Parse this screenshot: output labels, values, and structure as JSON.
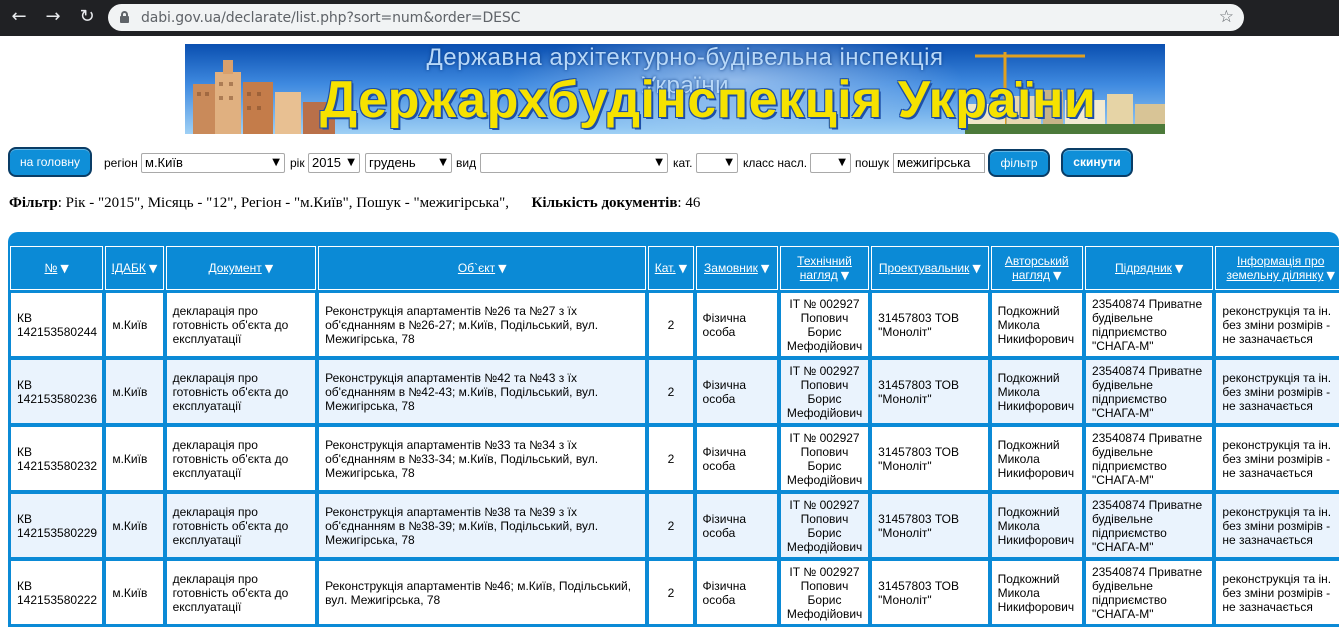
{
  "browser": {
    "url": "dabi.gov.ua/declarate/list.php?sort=num&order=DESC"
  },
  "banner": {
    "subtitle": "Державна архітектурно-будівельна інспекція України",
    "title": "Держархбудінспекція України"
  },
  "filters": {
    "home_button": "на головну",
    "region_label": "регіон",
    "region_value": "м.Київ",
    "year_label": "рік",
    "year_value": "2015",
    "month_value": "грудень",
    "type_label": "вид",
    "type_value": "",
    "cat_label": "кат.",
    "cat_value": "",
    "class_label": "класс насл.",
    "class_value": "",
    "search_label": "пошук",
    "search_value": "межигірська",
    "filter_button": "фільтр",
    "reset_button": "скинути"
  },
  "summary": {
    "filter_label": "Фільтр",
    "filter_text": ": Рік - \"2015\", Місяць - \"12\", Регіон - \"м.Київ\", Пошук - \"межигірська\",",
    "count_label": "Кількість документів",
    "count_value": ": 46"
  },
  "table": {
    "headers": [
      "№",
      "ІДАБК",
      "Документ",
      "Об`єкт",
      "Кат.",
      "Замовник",
      "Технічний нагляд",
      "Проектувальник",
      "Авторський нагляд",
      "Підрядник",
      "Інформація про земельну ділянку"
    ],
    "rows": [
      {
        "num": "КВ 142153580244",
        "idabk": "м.Київ",
        "doc": "декларація про готовність об'єкта до експлуатації",
        "object": "Реконструкція апартаментів №26 та №27 з їх об'єднанням в №26-27; м.Київ, Подільський, вул. Межигірська, 78",
        "cat": "2",
        "customer": "Фізична особа",
        "tech": "ІТ № 002927 Попович Борис Мефодійович",
        "designer": "31457803 ТОВ \"Моноліт\"",
        "author": "Подкожний Микола Никифорович",
        "contractor": "23540874 Приватне будівельне підприємство \"СНАГА-М\"",
        "land": "реконструкція та ін. без зміни розмірів - не зазначається"
      },
      {
        "num": "КВ 142153580236",
        "idabk": "м.Київ",
        "doc": "декларація про готовність об'єкта до експлуатації",
        "object": "Реконструкція апартаментів №42 та №43 з їх об'єднанням в №42-43; м.Київ, Подільський, вул. Межигірська, 78",
        "cat": "2",
        "customer": "Фізична особа",
        "tech": "ІТ № 002927 Попович Борис Мефодійович",
        "designer": "31457803 ТОВ \"Моноліт\"",
        "author": "Подкожний Микола Никифорович",
        "contractor": "23540874 Приватне будівельне підприємство \"СНАГА-М\"",
        "land": "реконструкція та ін. без зміни розмірів - не зазначається"
      },
      {
        "num": "КВ 142153580232",
        "idabk": "м.Київ",
        "doc": "декларація про готовність об'єкта до експлуатації",
        "object": "Реконструкція апартаментів №33 та №34 з їх об'єднанням в №33-34; м.Київ, Подільський, вул. Межигірська, 78",
        "cat": "2",
        "customer": "Фізична особа",
        "tech": "ІТ № 002927 Попович Борис Мефодійович",
        "designer": "31457803 ТОВ \"Моноліт\"",
        "author": "Подкожний Микола Никифорович",
        "contractor": "23540874 Приватне будівельне підприємство \"СНАГА-М\"",
        "land": "реконструкція та ін. без зміни розмірів - не зазначається"
      },
      {
        "num": "КВ 142153580229",
        "idabk": "м.Київ",
        "doc": "декларація про готовність об'єкта до експлуатації",
        "object": "Реконструкція апартаментів №38 та №39 з їх об'єднанням в №38-39; м.Київ, Подільський, вул. Межигірська, 78",
        "cat": "2",
        "customer": "Фізична особа",
        "tech": "ІТ № 002927 Попович Борис Мефодійович",
        "designer": "31457803 ТОВ \"Моноліт\"",
        "author": "Подкожний Микола Никифорович",
        "contractor": "23540874 Приватне будівельне підприємство \"СНАГА-М\"",
        "land": "реконструкція та ін. без зміни розмірів - не зазначається"
      },
      {
        "num": "КВ 142153580222",
        "idabk": "м.Київ",
        "doc": "декларація про готовність об'єкта до експлуатації",
        "object": "Реконструкція апартаментів №46; м.Київ, Подільський, вул. Межигірська, 78",
        "cat": "2",
        "customer": "Фізична особа",
        "tech": "ІТ № 002927 Попович Борис Мефодійович",
        "designer": "31457803 ТОВ \"Моноліт\"",
        "author": "Подкожний Микола Никифорович",
        "contractor": "23540874 Приватне будівельне підприємство \"СНАГА-М\"",
        "land": "реконструкція та ін. без зміни розмірів - не зазначається"
      }
    ]
  },
  "colors": {
    "accent": "#0b8ad6",
    "row_alt": "#eaf3fd",
    "banner_title": "#f6e200"
  }
}
